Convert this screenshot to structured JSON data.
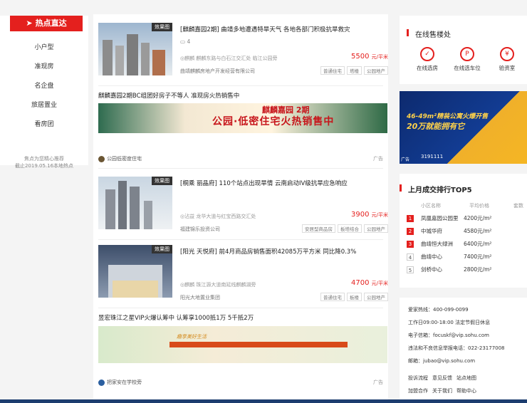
{
  "sidebar": {
    "hot_label": "热点直达",
    "items": [
      {
        "label": "小户型"
      },
      {
        "label": "准现房"
      },
      {
        "label": "名企盘"
      },
      {
        "label": "旅居置业"
      },
      {
        "label": "看房团"
      }
    ],
    "note_line1": "焦点为您精心推荐",
    "note_line2": "截止2019.05.16本地热点"
  },
  "feed": {
    "card1": {
      "tag": "效果图",
      "title": "[麒麟嘉园2期] 曲靖多地遭遇特旱天气 各地各部门积极抗旱救灾",
      "comments": "4",
      "address": "◎麒麟 麒麟东路与白石江交汇处 临江公园旁",
      "price": "5500",
      "unit": "元/平米",
      "developer": "曲靖麒麟房地产开发经营有限公司",
      "tags": [
        "普通住宅",
        "塔楼",
        "公园地产"
      ]
    },
    "ad1": {
      "title": "麒麟嘉园2期BC组团好房子不等人 准现房火热销售中",
      "banner_top": "麒麟嘉园 2期",
      "banner_text": "公园·低密住宅火热销售中",
      "sponsor": "公园低密度住宅",
      "ad_label": "广告"
    },
    "card2": {
      "tag": "效果图",
      "title": "[桐乘 丽晶府] 110个站点出现旱情 云南启动IV级抗旱应急响应",
      "address": "◎沾益 龙华大道与红宝西路交汇处",
      "price": "3900",
      "unit": "元/平米",
      "developer": "福建锦乐投资公司",
      "tags": [
        "安居型商品房",
        "板塔结合",
        "公园地产"
      ]
    },
    "card3": {
      "tag": "效果图",
      "title": "[阳光 天悦府] 前4月商品房销售面积42085万平方米 同比降0.3%",
      "address": "◎麒麟 珠江源大道南延线麒麟湖旁",
      "price": "4700",
      "unit": "元/平米",
      "developer": "阳光大地置业集团",
      "tags": [
        "普通住宅",
        "板楼",
        "公园地产"
      ]
    },
    "ad2": {
      "title": "昱宏珠江之星VIP火爆认筹中 认筹享1000抵1万 5千抵2万",
      "banner_line": "趣享美好生活",
      "sponsor": "把家安在学校旁",
      "ad_label": "广告"
    }
  },
  "right": {
    "online_title": "在线售楼处",
    "services": [
      {
        "label": "在线选房",
        "icon": "house-check-icon",
        "glyph": "✓"
      },
      {
        "label": "在线选车位",
        "icon": "parking-icon",
        "glyph": "P"
      },
      {
        "label": "验资室",
        "icon": "money-icon",
        "glyph": "¥"
      }
    ],
    "adbox": {
      "line1": "46-49m²精装公寓火爆开售",
      "line2": "20万就能拥有它",
      "phone": "3191111",
      "ad_label": "广告"
    },
    "rank": {
      "title": "上月成交排行TOP5",
      "headers": [
        "小区名称",
        "平均价格",
        "套数"
      ],
      "rows": [
        {
          "no": "1",
          "name": "凤凰嘉园公园里",
          "price": "4200元/m²"
        },
        {
          "no": "2",
          "name": "中城华府",
          "price": "4580元/m²"
        },
        {
          "no": "3",
          "name": "曲靖恒大绿洲",
          "price": "6400元/m²"
        },
        {
          "no": "4",
          "name": "曲靖中心",
          "price": "7400元/m²"
        },
        {
          "no": "5",
          "name": "剑桥中心",
          "price": "2800元/m²"
        }
      ]
    },
    "contact": {
      "hotline": "爱家热线：400-099-0099",
      "hours": "工作日09:00-18:00 法定节假日休息",
      "email": "电子信箱：focuskf@vip.sohu.com",
      "report": "违法和不良信息举报电话：022-23177008",
      "mail": "邮箱：jubao@vip.sohu.com",
      "links": [
        "投诉流程",
        "意见反馈",
        "站点地图"
      ],
      "links2": [
        "加盟合作",
        "关于我们",
        "帮助中心"
      ]
    }
  },
  "colors": {
    "accent": "#e4201e",
    "price": "#e4201e"
  }
}
